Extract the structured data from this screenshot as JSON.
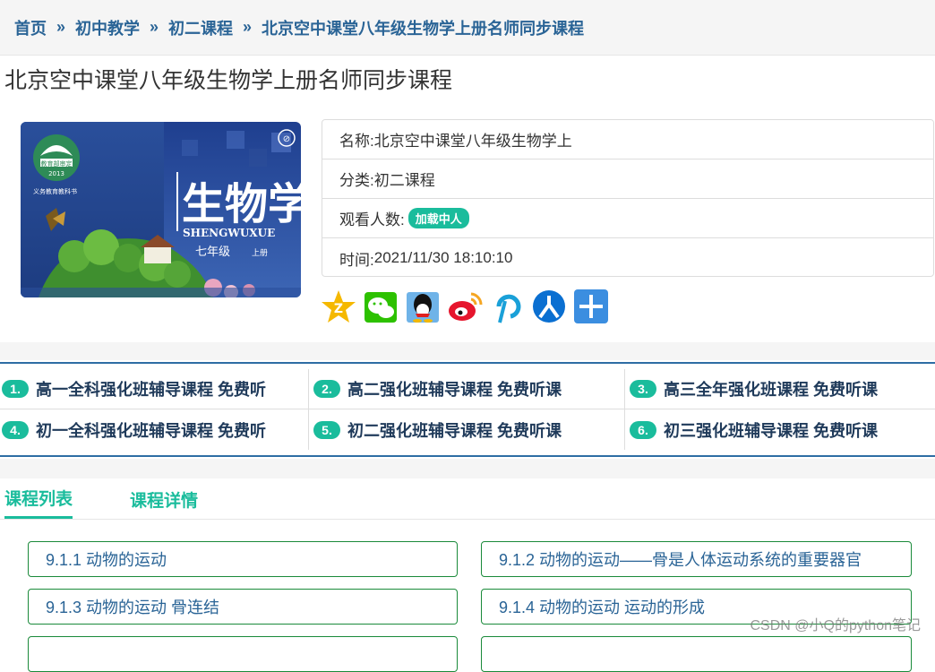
{
  "breadcrumb": {
    "home": "首页",
    "sep": "»",
    "level1": "初中教学",
    "level2": "初二课程",
    "current": "北京空中课堂八年级生物学上册名师同步课程"
  },
  "page_title": "北京空中课堂八年级生物学上册名师同步课程",
  "cover": {
    "title_cn": "生物学",
    "pinyin": "SHENGWUXUE",
    "grade": "七年级",
    "volume": "上册",
    "logo_year": "2013",
    "logo_text": "教育部审定",
    "series": "义务教育教科书"
  },
  "info": {
    "name_label": "名称:",
    "name_value": "北京空中课堂八年级生物学上",
    "category_label": "分类:",
    "category_value": "初二课程",
    "viewers_label": "观看人数:",
    "viewers_badge": "加载中人",
    "time_label": "时间:",
    "time_value": "2021/11/30 18:10:10"
  },
  "share_icons": [
    "qzone-icon",
    "wechat-icon",
    "qq-icon",
    "weibo-icon",
    "pinterest-icon",
    "renren-icon",
    "more-share-icon"
  ],
  "promo": [
    {
      "num": "1.",
      "text": "高一全科强化班辅导课程  免费听"
    },
    {
      "num": "2.",
      "text": "高二强化班辅导课程  免费听课"
    },
    {
      "num": "3.",
      "text": "高三全年强化班课程  免费听课"
    },
    {
      "num": "4.",
      "text": "初一全科强化班辅导课程  免费听"
    },
    {
      "num": "5.",
      "text": "初二强化班辅导课程  免费听课"
    },
    {
      "num": "6.",
      "text": "初三强化班辅导课程  免费听课"
    }
  ],
  "tabs": [
    "课程列表",
    "课程详情"
  ],
  "lessons": [
    "9.1.1 动物的运动",
    "9.1.2 动物的运动——骨是人体运动系统的重要器官",
    "9.1.3 动物的运动 骨连结",
    "9.1.4 动物的运动 运动的形成"
  ],
  "watermark": "CSDN @小Q的python笔记",
  "colors": {
    "accent": "#1abc9c",
    "link": "#2a6496",
    "promo_border": "#2e6da4",
    "lesson_border": "#1a8a3a"
  }
}
